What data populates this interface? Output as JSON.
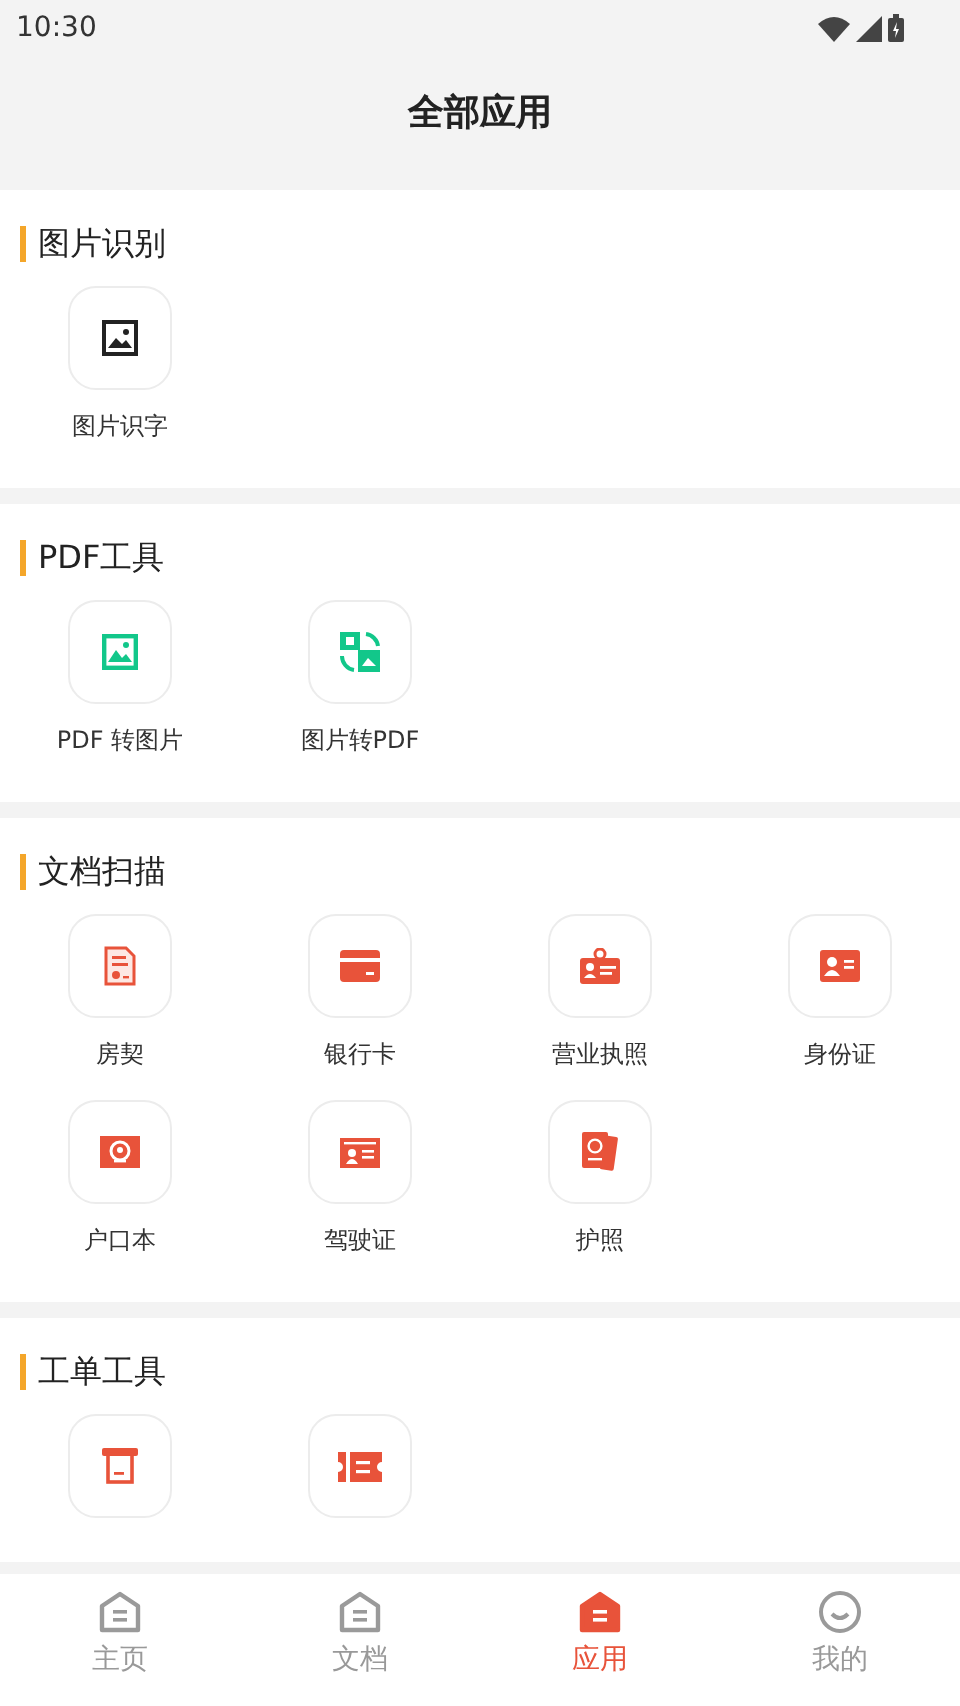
{
  "status_bar": {
    "time": "10:30"
  },
  "header": {
    "title": "全部应用"
  },
  "sections": [
    {
      "title": "图片识别",
      "items": [
        {
          "label": "图片识字",
          "kind": "image-frame"
        }
      ]
    },
    {
      "title": "PDF工具",
      "items": [
        {
          "label": "PDF 转图片",
          "kind": "image-green"
        },
        {
          "label": "图片转PDF",
          "kind": "convert"
        }
      ]
    },
    {
      "title": "文档扫描",
      "items": [
        {
          "label": "房契",
          "kind": "document"
        },
        {
          "label": "银行卡",
          "kind": "card"
        },
        {
          "label": "营业执照",
          "kind": "badge"
        },
        {
          "label": "身份证",
          "kind": "idcard"
        },
        {
          "label": "户口本",
          "kind": "emblem"
        },
        {
          "label": "驾驶证",
          "kind": "license"
        },
        {
          "label": "护照",
          "kind": "passport"
        }
      ]
    },
    {
      "title": "工单工具",
      "items": [
        {
          "kind": "receipt"
        },
        {
          "kind": "ticket"
        }
      ]
    }
  ],
  "tab_bar": [
    {
      "label": "主页",
      "kind": "home",
      "selected": false
    },
    {
      "label": "文档",
      "kind": "home",
      "selected": false
    },
    {
      "label": "应用",
      "kind": "home",
      "selected": true
    },
    {
      "label": "我的",
      "kind": "smile",
      "selected": false
    }
  ]
}
